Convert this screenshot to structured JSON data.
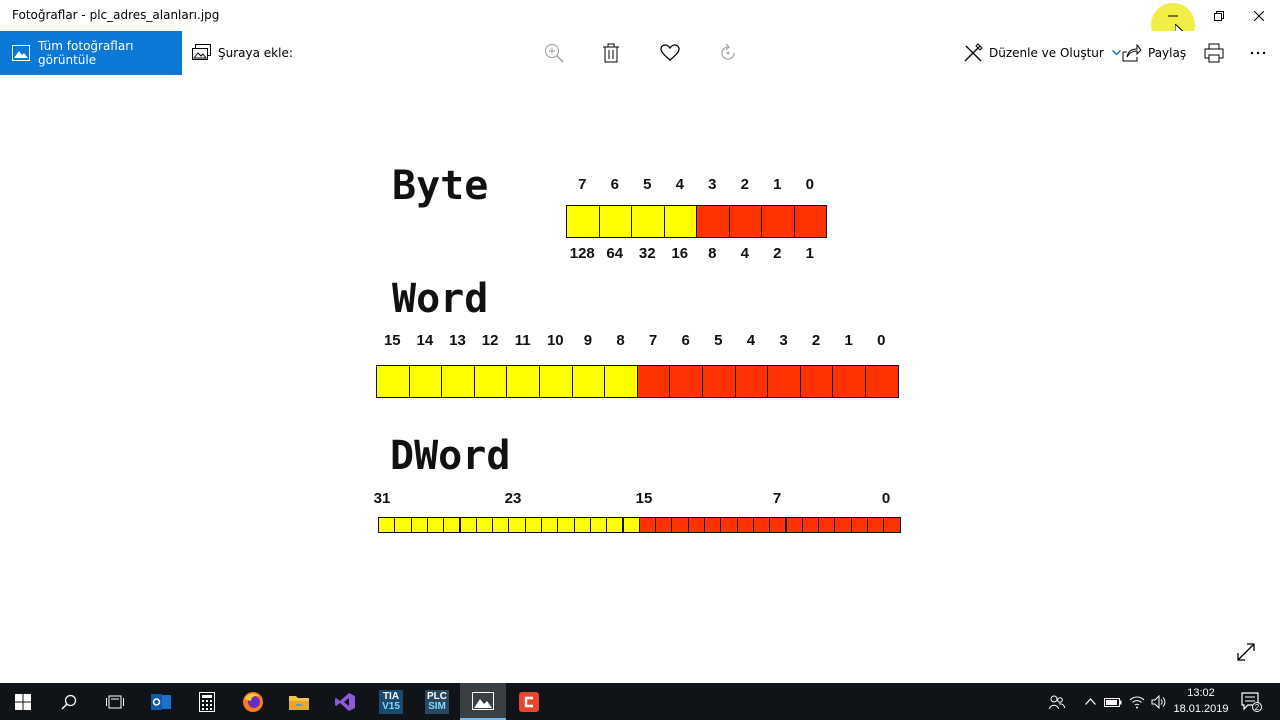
{
  "window": {
    "title": "Fotoğraflar - plc_adres_alanları.jpg"
  },
  "toolbar": {
    "view_all_label": "Tüm fotoğrafları görüntüle",
    "add_to_label": "Şuraya ekle:",
    "edit_create_label": "Düzenle ve Oluştur",
    "share_label": "Paylaş",
    "accent_color": "#0a78d4"
  },
  "image": {
    "byte": {
      "label": "Byte",
      "bit_numbers": [
        "7",
        "6",
        "5",
        "4",
        "3",
        "2",
        "1",
        "0"
      ],
      "weights": [
        "128",
        "64",
        "32",
        "16",
        "8",
        "4",
        "2",
        "1"
      ],
      "cell_colors": [
        "yellow",
        "yellow",
        "yellow",
        "yellow",
        "red",
        "red",
        "red",
        "red"
      ]
    },
    "word": {
      "label": "Word",
      "bit_numbers": [
        "15",
        "14",
        "13",
        "12",
        "11",
        "10",
        "9",
        "8",
        "7",
        "6",
        "5",
        "4",
        "3",
        "2",
        "1",
        "0"
      ],
      "cell_colors": [
        "yellow",
        "yellow",
        "yellow",
        "yellow",
        "yellow",
        "yellow",
        "yellow",
        "yellow",
        "red",
        "red",
        "red",
        "red",
        "red",
        "red",
        "red",
        "red"
      ]
    },
    "dword": {
      "label": "DWord",
      "bit_numbers": [
        "31",
        "23",
        "15",
        "7",
        "0"
      ],
      "yellow_cells": 16,
      "red_cells": 16
    },
    "colors": {
      "yellow": "#ffff00",
      "red": "#ff3300"
    }
  },
  "taskbar": {
    "apps": [
      {
        "name": "start-icon"
      },
      {
        "name": "search-icon"
      },
      {
        "name": "task-view-icon"
      },
      {
        "name": "outlook-icon"
      },
      {
        "name": "calculator-icon"
      },
      {
        "name": "firefox-icon"
      },
      {
        "name": "file-explorer-icon"
      },
      {
        "name": "visual-studio-icon"
      },
      {
        "name": "tia-portal-icon",
        "text": "TIA\nV15"
      },
      {
        "name": "plcsim-icon",
        "text": "PLC\nSIM"
      },
      {
        "name": "photos-icon"
      },
      {
        "name": "camtasia-icon"
      }
    ],
    "tia_label_top": "TIA",
    "tia_label_bottom": "V15",
    "plcsim_label_top": "PLC",
    "plcsim_label_bottom": "SIM",
    "time": "13:02",
    "date": "18.01.2019",
    "notification_count": "2"
  }
}
